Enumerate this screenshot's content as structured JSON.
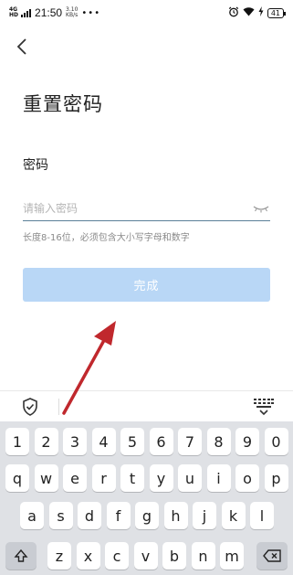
{
  "status_bar": {
    "network": "4G",
    "network_sub": "HD",
    "time": "21:50",
    "speed_value": "3.10",
    "speed_unit": "KB/s",
    "dots": "•••",
    "battery": "41"
  },
  "header": {
    "back_icon": "chevron-left-icon"
  },
  "page": {
    "title": "重置密码",
    "field_label": "密码",
    "password_placeholder": "请输入密码",
    "password_value": "",
    "hint": "长度8-16位，必须包含大小写字母和数字",
    "done_label": "完成"
  },
  "keyboard": {
    "toolbar_left_icon": "shield-check-icon",
    "toolbar_right_icon": "keyboard-collapse-icon",
    "row1": [
      "1",
      "2",
      "3",
      "4",
      "5",
      "6",
      "7",
      "8",
      "9",
      "0"
    ],
    "row2": [
      "q",
      "w",
      "e",
      "r",
      "t",
      "y",
      "u",
      "i",
      "o",
      "p"
    ],
    "row3": [
      "a",
      "s",
      "d",
      "f",
      "g",
      "h",
      "j",
      "k",
      "l"
    ],
    "row4": [
      "z",
      "x",
      "c",
      "v",
      "b",
      "n",
      "m"
    ],
    "shift_icon": "shift-icon",
    "backspace_icon": "backspace-icon"
  },
  "colors": {
    "button_bg": "#b9d7f6",
    "input_underline": "#5a7f98",
    "arrow": "#c0282d",
    "keyboard_bg": "#dfe1e5"
  }
}
